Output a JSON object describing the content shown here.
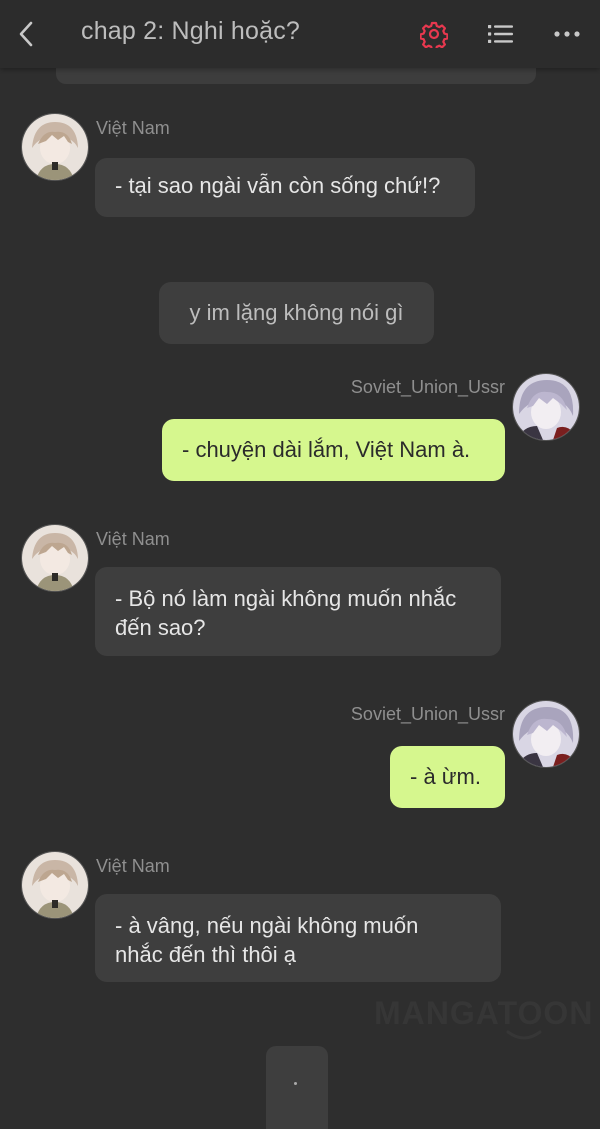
{
  "header": {
    "title": "chap 2: Nghi hoặc?",
    "accent_color": "#e8384f",
    "icons": [
      "back-arrow-icon",
      "gear-icon",
      "list-icon",
      "more-icon"
    ]
  },
  "messages": [
    {
      "speaker": "Việt Nam",
      "text": "- tại sao ngài vẫn còn sống chứ!?"
    },
    {
      "narration": "y im lặng không nói gì"
    },
    {
      "speaker": "Soviet_Union_Ussr",
      "text": "- chuyện dài lắm, Việt Nam à."
    },
    {
      "speaker": "Việt Nam",
      "line1": "- Bộ nó làm ngài không muốn nhắc",
      "line2": "đến sao?"
    },
    {
      "speaker": "Soviet_Union_Ussr",
      "text": "- à ừm."
    },
    {
      "speaker": "Việt Nam",
      "line1": "- à vâng, nếu ngài không muốn",
      "line2": "nhắc đến thì thôi ạ"
    }
  ],
  "watermark": "MANGATOON",
  "colors": {
    "background": "#2e2e2e",
    "left_bubble": "#3e3e3e",
    "right_bubble": "#d6f78e"
  }
}
